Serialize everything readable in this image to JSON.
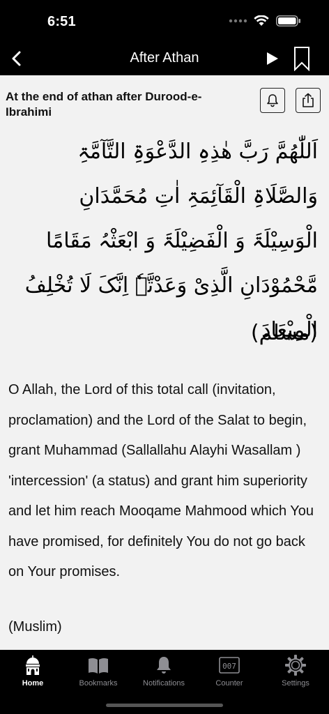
{
  "status_bar": {
    "time": "6:51"
  },
  "nav": {
    "title": "After Athan"
  },
  "content": {
    "heading": "At the end of athan after Durood-e-Ibrahimi",
    "arabic_text": "اَللّٰھُمَّ رَبَّ ھٰذِہِ الدَّعْوَۃِ التَّآمَّۃِ وَالصَّلَاۃِ الْقَآئِمَۃِ اٰتِ مُحَمَّدَانِ الْوَسِیْلَۃَ وَ الْفَضِیْلَۃَ وَ ابْعَثْہُ مَقَامًا مَّحْمُوْدَانِ الَّذِیْ وَعَدْتَّہٗ اِنَّکَ لَا تُخْلِفُ الْمِیْعَادَ",
    "arabic_source": "(مسلم)",
    "translation": "O Allah, the Lord of this total call (invitation, proclamation) and the Lord of the Salat to begin, grant Muhammad (Sallallahu Alayhi Wasallam ) 'intercession' (a status) and grant him superiority and let him reach Mooqame Mahmood which You have promised, for definitely You do not go back on Your promises.",
    "translation_source": "(Muslim)"
  },
  "tabs": [
    {
      "label": "Home",
      "icon": "mosque-icon",
      "active": true
    },
    {
      "label": "Bookmarks",
      "icon": "book-icon",
      "active": false
    },
    {
      "label": "Notifications",
      "icon": "bell-icon",
      "active": false
    },
    {
      "label": "Counter",
      "icon": "counter-icon",
      "counter_digits": "007",
      "active": false
    },
    {
      "label": "Settings",
      "icon": "gear-icon",
      "active": false
    }
  ],
  "colors": {
    "bar_background": "#000000",
    "content_background": "#f2f2f2",
    "tab_inactive": "#8e8e93",
    "tab_active": "#ffffff"
  }
}
